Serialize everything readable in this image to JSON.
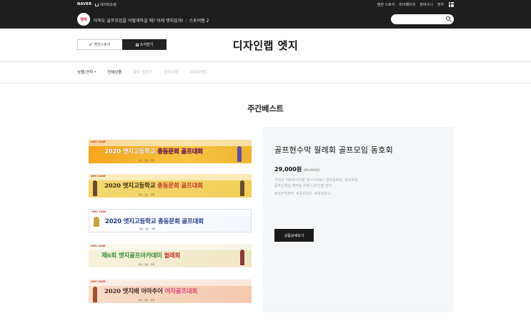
{
  "gnb": {
    "naver_logo": "NAVER",
    "home_link": "네이버쇼핑",
    "util_links": [
      "찜한 스토어",
      "마이페이지",
      "장바구니",
      "엣지"
    ],
    "store_badge": "엣지",
    "ticker_text": "아직도 골프모임을 어떻게하실 때? 이제 엣지입게!",
    "ticker_store": "스토어찜 2",
    "search_placeholder": ""
  },
  "store": {
    "title": "디자인랩 엣지",
    "fav_button": "찜한스토어",
    "news_button": "소식받기"
  },
  "nav": {
    "items": [
      {
        "label": "상품/견적",
        "active": true,
        "has_caret": true
      },
      {
        "label": "전체상품",
        "active": true,
        "has_caret": false
      },
      {
        "label": "골프 잡화기",
        "active": false,
        "has_caret": false
      },
      {
        "label": "공지사항",
        "active": false,
        "has_caret": false
      },
      {
        "label": "리뷰이벤트",
        "active": false,
        "has_caret": false
      }
    ]
  },
  "section": {
    "title": "주간베스트"
  },
  "banners": [
    {
      "brand": "UMC CAGE",
      "text_main": "2020 엣지고등학교 ",
      "text_hl": "총동문회 골프대회",
      "sub": "일시 · 장소 · 주최"
    },
    {
      "brand": "UMC CAGE",
      "text_main": "2020 엣지고등학교 ",
      "text_hl": "총동문회 골프대회",
      "sub": "일시 · 장소 · 주최"
    },
    {
      "brand": "UMC CAGE",
      "text_main": "2020 엣지고등학교 ",
      "text_hl": "총동문회 골프대회",
      "sub": "일시 · 장소 · 주최"
    },
    {
      "brand": "UMC CAGE",
      "text_main": "제6회 엣지골프아카데미 ",
      "text_hl": "월례회",
      "sub": "일시 · 장소 · 주최"
    },
    {
      "brand": "UMC CAGE",
      "text_main": "2020 엣지배 아마추어 ",
      "text_hl": "여자골프대회",
      "sub": "일시 · 장소 · 주최"
    }
  ],
  "product": {
    "name": "골프현수막 월례회 골프모임 동호회",
    "price": "29,000원",
    "price_old": "35,000원",
    "description": "아직도 어떠주어야할 엔시커세요? 골프동호회, 골프모임, 골프단체일 제작을 위해 디자인랩 엣지 -",
    "tags": [
      "#현수막제작",
      "#골프현수",
      "#월례회드"
    ],
    "detail_button": "상품상세보기"
  },
  "colors": {
    "gnb_bg": "#1e1e1e",
    "panel_bg": "#f4f6f8",
    "accent_dark": "#1a1a1a"
  }
}
